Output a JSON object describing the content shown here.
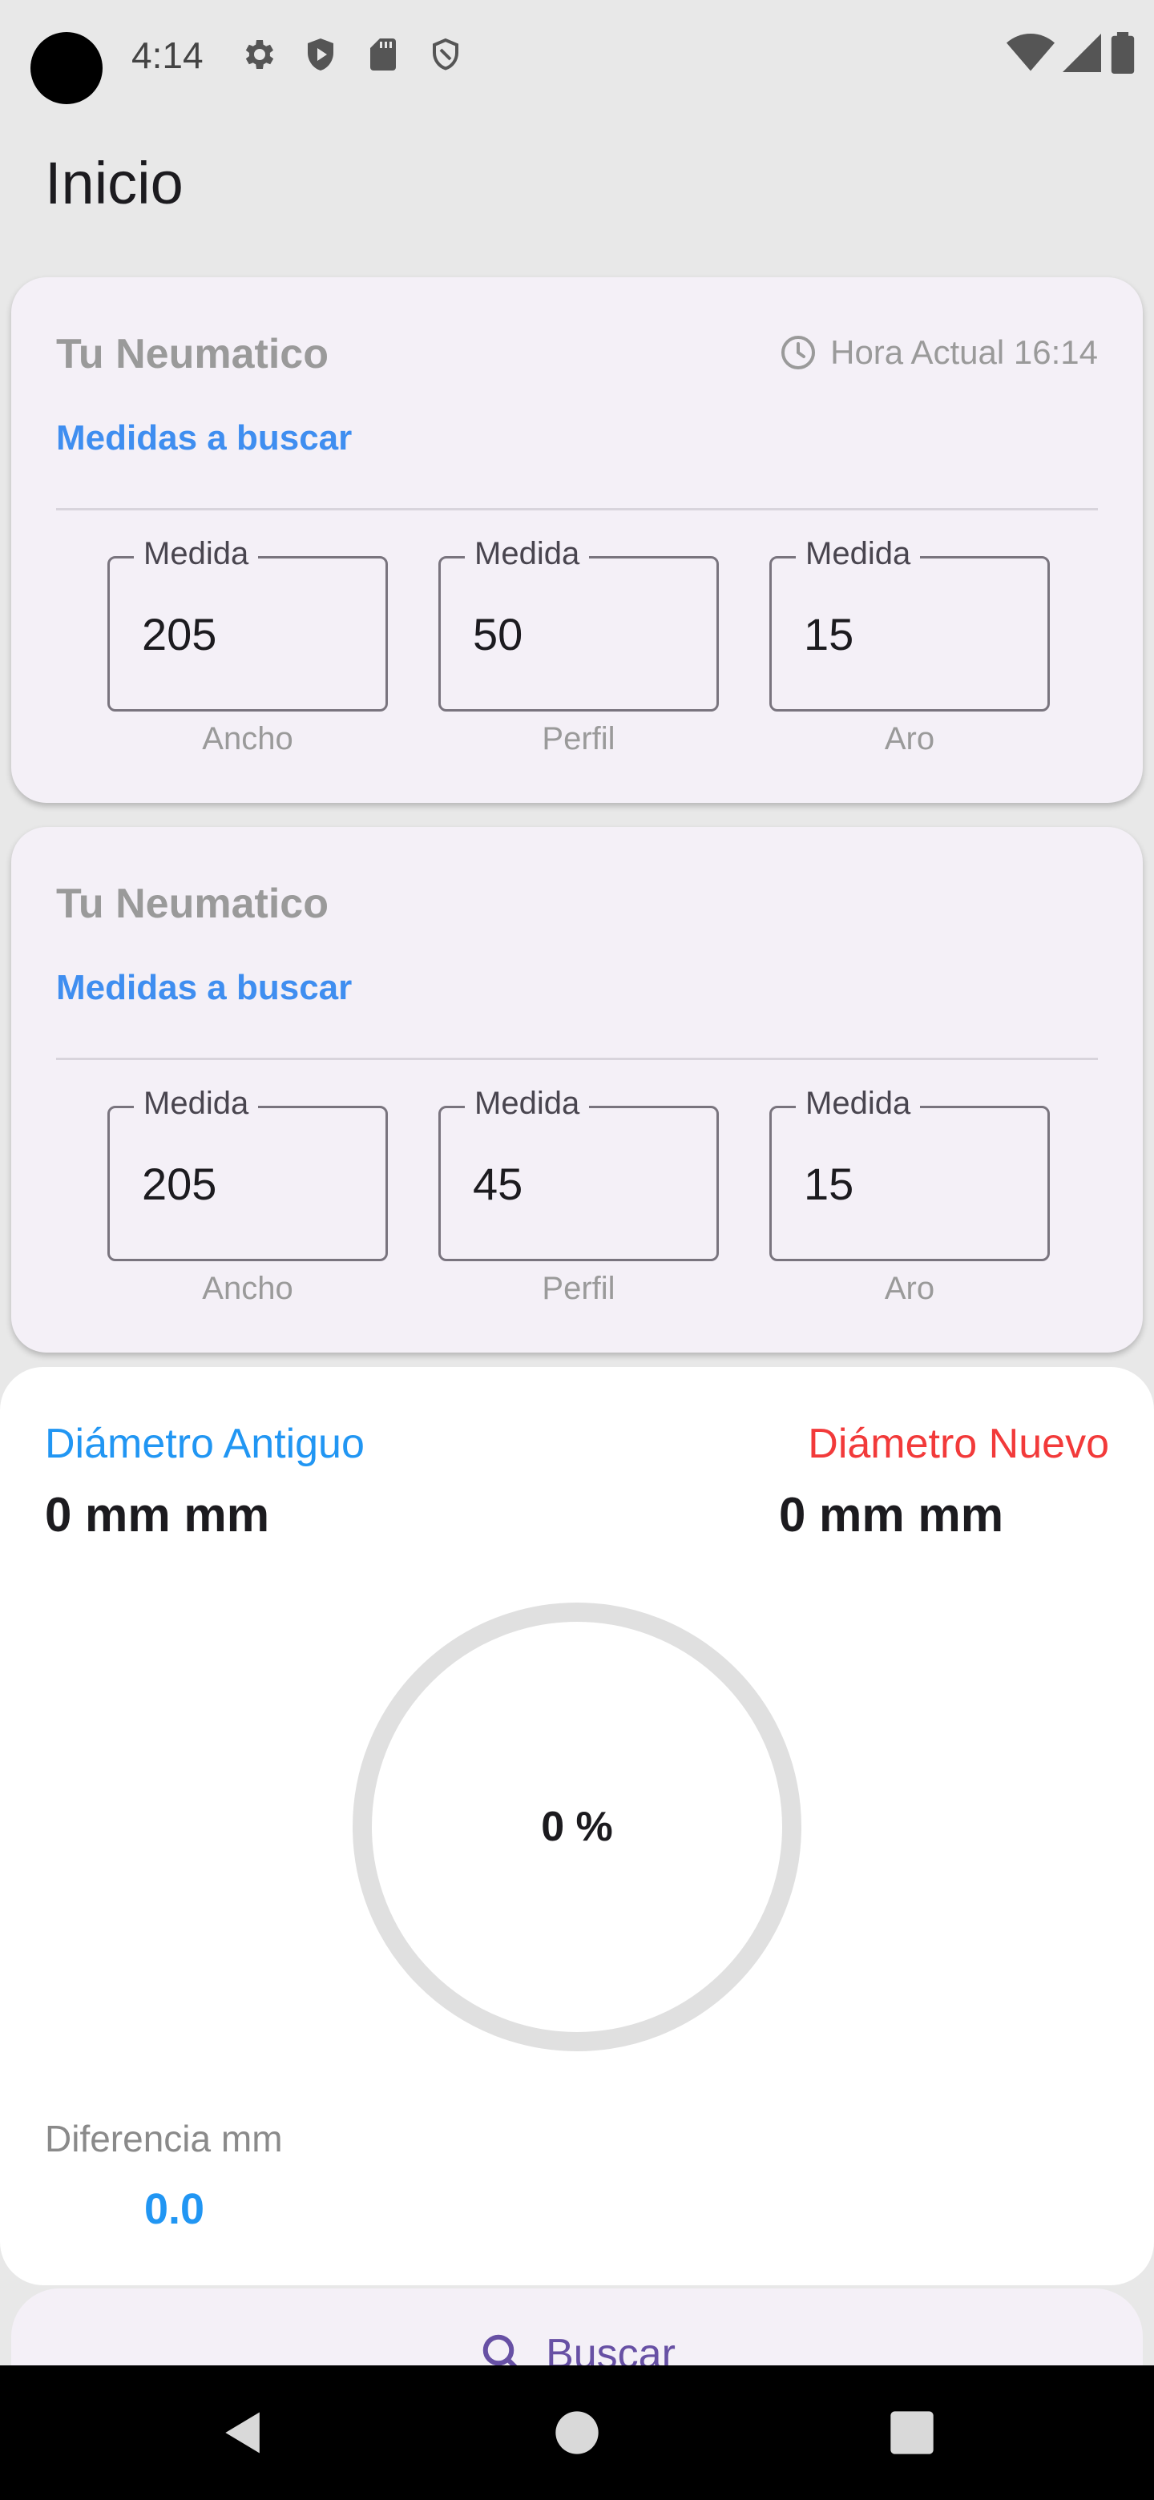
{
  "status_bar": {
    "time": "4:14",
    "left_icons": [
      "settings-gear-icon",
      "shield-play-icon",
      "sd-card-icon",
      "shield-outline-icon"
    ],
    "right_icons": [
      "wifi-icon",
      "cell-signal-icon",
      "battery-icon"
    ]
  },
  "app_bar": {
    "title": "Inicio"
  },
  "card_old": {
    "title": "Tu Neumatico",
    "time_text": "Hora Actual 16:14",
    "subtitle": "Medidas a buscar",
    "fields": [
      {
        "label": "Medida",
        "value": "205",
        "caption": "Ancho"
      },
      {
        "label": "Medida",
        "value": "50",
        "caption": "Perfil"
      },
      {
        "label": "Medida",
        "value": "15",
        "caption": "Aro"
      }
    ]
  },
  "card_new": {
    "title": "Tu Neumatico",
    "subtitle": "Medidas a buscar",
    "fields": [
      {
        "label": "Medida",
        "value": "205",
        "caption": "Ancho"
      },
      {
        "label": "Medida",
        "value": "45",
        "caption": "Perfil"
      },
      {
        "label": "Medida",
        "value": "15",
        "caption": "Aro"
      }
    ]
  },
  "result": {
    "old_label": "Diámetro Antiguo",
    "old_value": "0 mm mm",
    "new_label": "Diámetro Nuevo",
    "new_value": "0 mm mm",
    "percent_text": "0 %",
    "percent": 0,
    "diff_label": "Diferencia mm",
    "diff_value": "0.0"
  },
  "search_button": {
    "label": "Buscar"
  },
  "colors": {
    "accent_blue": "#2196f3",
    "link_blue": "#3f8ef0",
    "accent_red": "#f23a3a",
    "primary_purple": "#6750a4",
    "card_bg": "#f4f0f7"
  }
}
